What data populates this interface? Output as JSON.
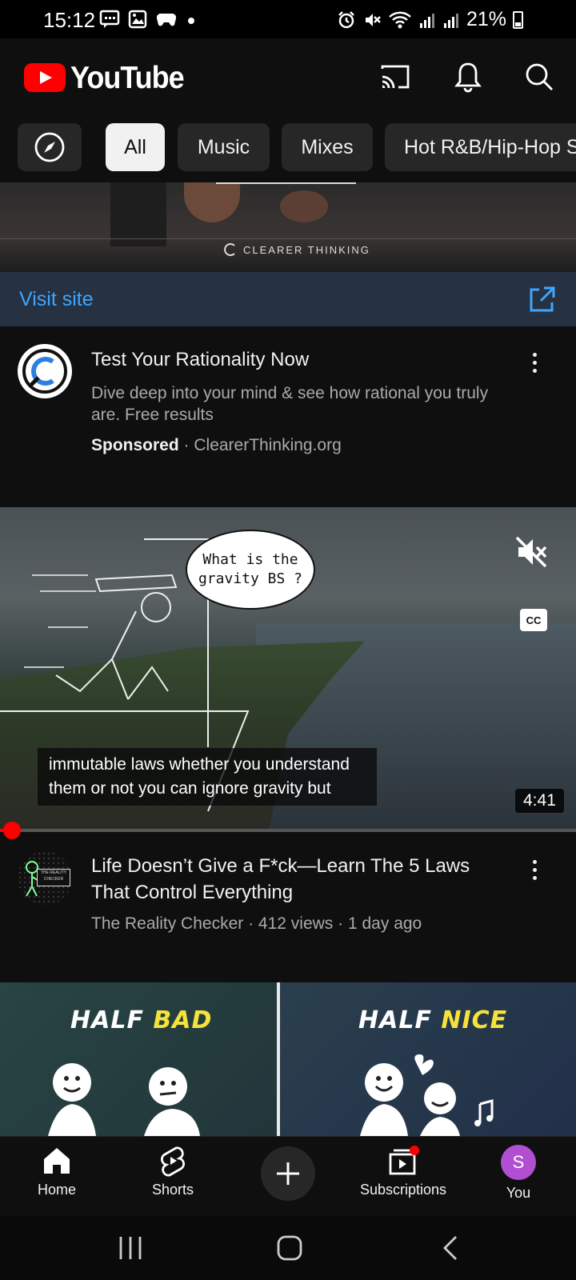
{
  "status_bar": {
    "time": "15:12",
    "battery": "21%"
  },
  "header": {
    "logo_text": "YouTube",
    "icons": [
      "cast-icon",
      "notifications-bell-icon",
      "search-icon"
    ]
  },
  "chips": {
    "explore_icon": "compass-icon",
    "items": [
      {
        "label": "All",
        "active": true
      },
      {
        "label": "Music",
        "active": false
      },
      {
        "label": "Mixes",
        "active": false
      },
      {
        "label": "Hot R&B/Hip-Hop S",
        "active": false
      }
    ]
  },
  "ad": {
    "banner_brand": "CLEARER THINKING",
    "visit_label": "Visit site",
    "title": "Test Your Rationality Now",
    "description": "Dive deep into your mind & see how rational you truly are. Free results",
    "sponsored": "Sponsored",
    "separator": " · ",
    "domain": "ClearerThinking.org"
  },
  "video": {
    "bubble_text": "What is the gravity BS ?",
    "cc_label": "CC",
    "caption_line1": "immutable laws whether you understand",
    "caption_line2": "them or not you can ignore gravity but",
    "duration": "4:41",
    "progress": 0.02,
    "channel_tag": "THE REALITY CHECKER",
    "title": "Life Doesn’t Give a F*ck—Learn The 5 Laws That Control Everything",
    "channel": "The Reality Checker",
    "views": "412 views",
    "age": "1 day ago",
    "meta_sep": " · "
  },
  "next_thumbnail": {
    "left_word1": "HALF",
    "left_word2": "BAD",
    "right_word1": "HALF",
    "right_word2": "NICE"
  },
  "bottom_nav": {
    "home": "Home",
    "shorts": "Shorts",
    "subscriptions": "Subscriptions",
    "you": "You",
    "you_initial": "S"
  },
  "colors": {
    "background": "#0f0f0f",
    "brand_red": "#ff0000",
    "link_blue": "#3ea6ff",
    "avatar_purple": "#b04fd1"
  }
}
